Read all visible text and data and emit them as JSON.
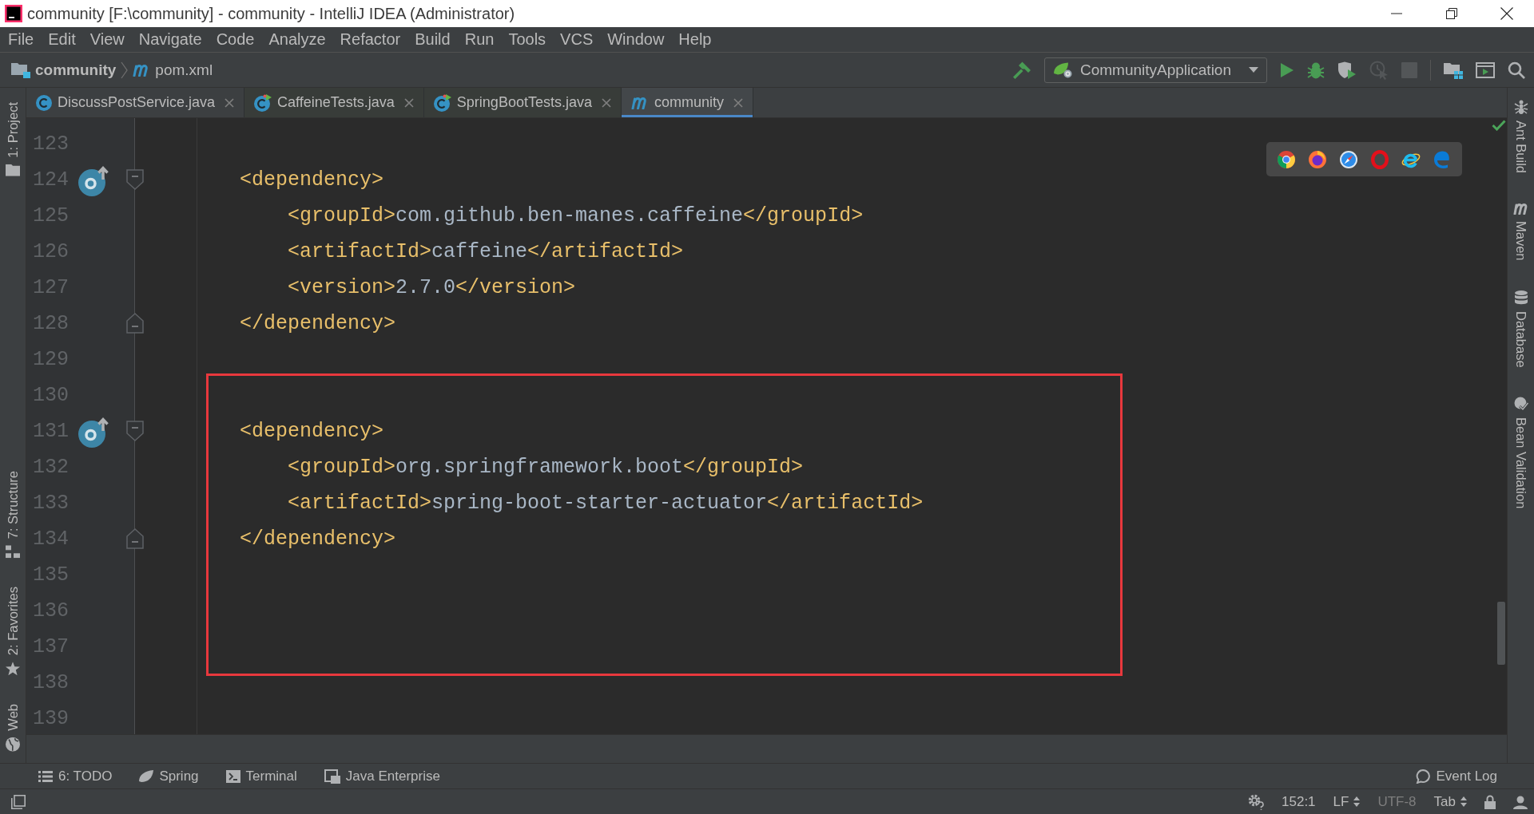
{
  "window": {
    "title": "community [F:\\community] - community - IntelliJ IDEA (Administrator)"
  },
  "menu": [
    "File",
    "Edit",
    "View",
    "Navigate",
    "Code",
    "Analyze",
    "Refactor",
    "Build",
    "Run",
    "Tools",
    "VCS",
    "Window",
    "Help"
  ],
  "navigation_bar": {
    "breadcrumbs": [
      {
        "kind": "project",
        "label": "community"
      },
      {
        "kind": "file",
        "label": "pom.xml"
      }
    ],
    "build_actions": [
      {
        "kind": "build",
        "disabled": false
      }
    ],
    "run_configuration": "CommunityApplication",
    "run_actions": [
      {
        "kind": "run",
        "disabled": false
      },
      {
        "kind": "debug",
        "disabled": false
      },
      {
        "kind": "coverage",
        "disabled": false
      },
      {
        "kind": "profile",
        "disabled": true
      },
      {
        "kind": "stop",
        "disabled": true
      }
    ],
    "tool_actions": [
      {
        "kind": "project-structure"
      },
      {
        "kind": "run-window"
      },
      {
        "kind": "search"
      }
    ]
  },
  "tabs": [
    {
      "kind": "class",
      "label": "DiscussPostService.java",
      "selected": false
    },
    {
      "kind": "test-class",
      "label": "CaffeineTests.java",
      "selected": false
    },
    {
      "kind": "test-class",
      "label": "SpringBootTests.java",
      "selected": false
    },
    {
      "kind": "maven",
      "label": "community",
      "selected": true
    }
  ],
  "left_stripe": {
    "top": [
      {
        "kind": "project",
        "label": "1: Project"
      }
    ],
    "bottom": [
      {
        "kind": "structure",
        "label": "7: Structure"
      },
      {
        "kind": "favorites",
        "label": "2: Favorites"
      },
      {
        "kind": "web",
        "label": "Web"
      }
    ]
  },
  "right_stripe": [
    {
      "kind": "ant",
      "label": "Ant Build"
    },
    {
      "kind": "maven",
      "label": "Maven"
    },
    {
      "kind": "database",
      "label": "Database"
    },
    {
      "kind": "bean-validation",
      "label": "Bean Validation"
    }
  ],
  "editor": {
    "browsers": [
      {
        "kind": "chrome"
      },
      {
        "kind": "firefox"
      },
      {
        "kind": "safari"
      },
      {
        "kind": "opera"
      },
      {
        "kind": "ie"
      },
      {
        "kind": "edge"
      }
    ],
    "lines": [
      {
        "number": "123",
        "marker": false
      },
      {
        "number": "124",
        "marker": true,
        "fold": {
          "kind": "start"
        },
        "tokens": [
          {
            "kind": "tag",
            "text": "<dependency>"
          }
        ],
        "children": [
          {
            "number": "125",
            "marker": false,
            "tokens": [
              {
                "kind": "tag",
                "text": "<groupId>"
              },
              {
                "kind": "value",
                "text": "com.github.ben-manes.caffeine"
              },
              {
                "kind": "tag",
                "text": "</groupId>"
              }
            ]
          },
          {
            "number": "126",
            "marker": false,
            "tokens": [
              {
                "kind": "tag",
                "text": "<artifactId>"
              },
              {
                "kind": "value",
                "text": "caffeine"
              },
              {
                "kind": "tag",
                "text": "</artifactId>"
              }
            ]
          },
          {
            "number": "127",
            "marker": false,
            "tokens": [
              {
                "kind": "tag",
                "text": "<version>"
              },
              {
                "kind": "value",
                "text": "2.7.0"
              },
              {
                "kind": "tag",
                "text": "</version>"
              }
            ]
          }
        ]
      },
      {
        "number": "128",
        "marker": false,
        "fold": {
          "kind": "end"
        },
        "tokens": [
          {
            "kind": "tag",
            "text": "</dependency>"
          }
        ]
      },
      {
        "number": "129",
        "marker": false
      },
      {
        "number": "130",
        "marker": false
      },
      {
        "number": "131",
        "marker": true,
        "fold": {
          "kind": "start"
        },
        "tokens": [
          {
            "kind": "tag",
            "text": "<dependency>"
          }
        ],
        "children": [
          {
            "number": "132",
            "marker": false,
            "tokens": [
              {
                "kind": "tag",
                "text": "<groupId>"
              },
              {
                "kind": "value",
                "text": "org.springframework.boot"
              },
              {
                "kind": "tag",
                "text": "</groupId>"
              }
            ]
          },
          {
            "number": "133",
            "marker": false,
            "tokens": [
              {
                "kind": "tag",
                "text": "<artifactId>"
              },
              {
                "kind": "value",
                "text": "spring-boot-starter-actuator"
              },
              {
                "kind": "tag",
                "text": "</artifactId>"
              }
            ]
          }
        ]
      },
      {
        "number": "134",
        "marker": false,
        "fold": {
          "kind": "end"
        },
        "tokens": [
          {
            "kind": "tag",
            "text": "</dependency>"
          }
        ]
      },
      {
        "number": "135",
        "marker": false
      },
      {
        "number": "136",
        "marker": false
      },
      {
        "number": "137",
        "marker": false
      },
      {
        "number": "138",
        "marker": false
      },
      {
        "number": "139",
        "marker": false
      }
    ]
  },
  "tool_windows": {
    "left": [
      {
        "kind": "todo",
        "label": "6: TODO"
      },
      {
        "kind": "spring",
        "label": "Spring"
      },
      {
        "kind": "terminal",
        "label": "Terminal"
      },
      {
        "kind": "enterprise",
        "label": "Java Enterprise"
      }
    ],
    "right": [
      {
        "kind": "event-log",
        "label": "Event Log"
      }
    ]
  },
  "status_bar": {
    "items": [
      {
        "kind": "inspection",
        "disabled": false
      },
      {
        "kind": "text",
        "label": "152:1",
        "disabled": false
      },
      {
        "kind": "dropdown",
        "label": "LF",
        "disabled": false
      },
      {
        "kind": "text",
        "label": "UTF-8",
        "disabled": true
      },
      {
        "kind": "dropdown",
        "label": "Tab",
        "disabled": false
      },
      {
        "kind": "lock",
        "disabled": false
      },
      {
        "kind": "inspector",
        "disabled": false
      }
    ]
  }
}
